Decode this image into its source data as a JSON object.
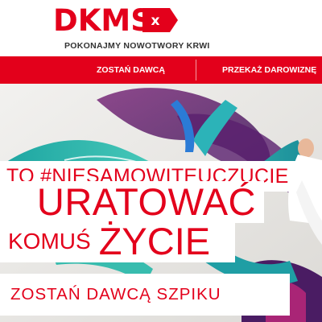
{
  "brand": {
    "logo_text": "DKMS",
    "logo_badge_glyph": "x",
    "tagline": "POKONAJMY NOWOTWORY KRWI",
    "accent_color": "#e3001b"
  },
  "nav": {
    "items": [
      {
        "label": "ZOSTAŃ DAWCĄ"
      },
      {
        "label": "PRZEKAŻ DAROWIZNĘ"
      }
    ]
  },
  "hero": {
    "hashtag_line": "TO #NIESAMOWITEUCZUCIE",
    "headline_line1": "URATOWAĆ",
    "headline_line2_small": "KOMUŚ",
    "headline_line2_big": "ŻYCIE",
    "cta_label": "ZOSTAŃ DAWCĄ SZPIKU",
    "background_description_icon": "graffiti-mural-image"
  }
}
